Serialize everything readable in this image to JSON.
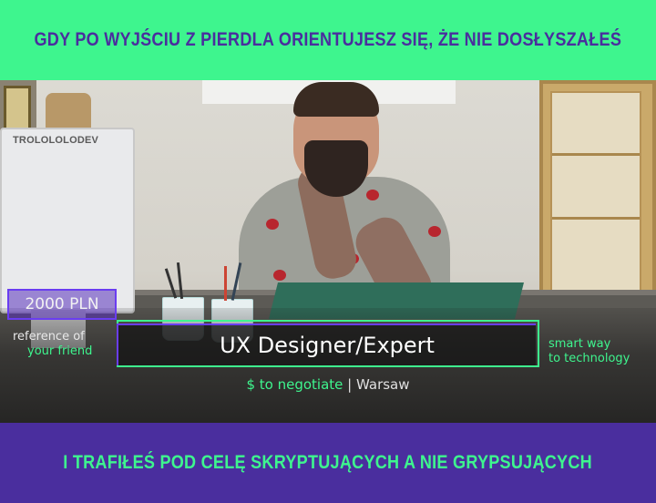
{
  "meme": {
    "top_caption": "GDY PO WYJŚCIU Z PIERDLA ORIENTUJESZ SIĘ, ŻE NIE DOSŁYSZAŁEŚ",
    "bottom_caption": "I TRAFIŁEŚ POD CELĘ SKRYPTUJĄCYCH A NIE GRYPSUJĄCYCH"
  },
  "photo": {
    "monitor_label": "TROLOLOLODEV"
  },
  "ad": {
    "price": "2000 PLN",
    "reference_line1": "reference of",
    "reference_line2": "your friend",
    "job_title": "UX Designer/Expert",
    "salary_note": "$ to negotiate",
    "separator": "|",
    "city": "Warsaw",
    "tagline_line1": "smart way",
    "tagline_line2": "to technology"
  },
  "colors": {
    "green": "#3ef58e",
    "purple": "#4a2e9e",
    "accent_purple": "#6a3df0"
  }
}
